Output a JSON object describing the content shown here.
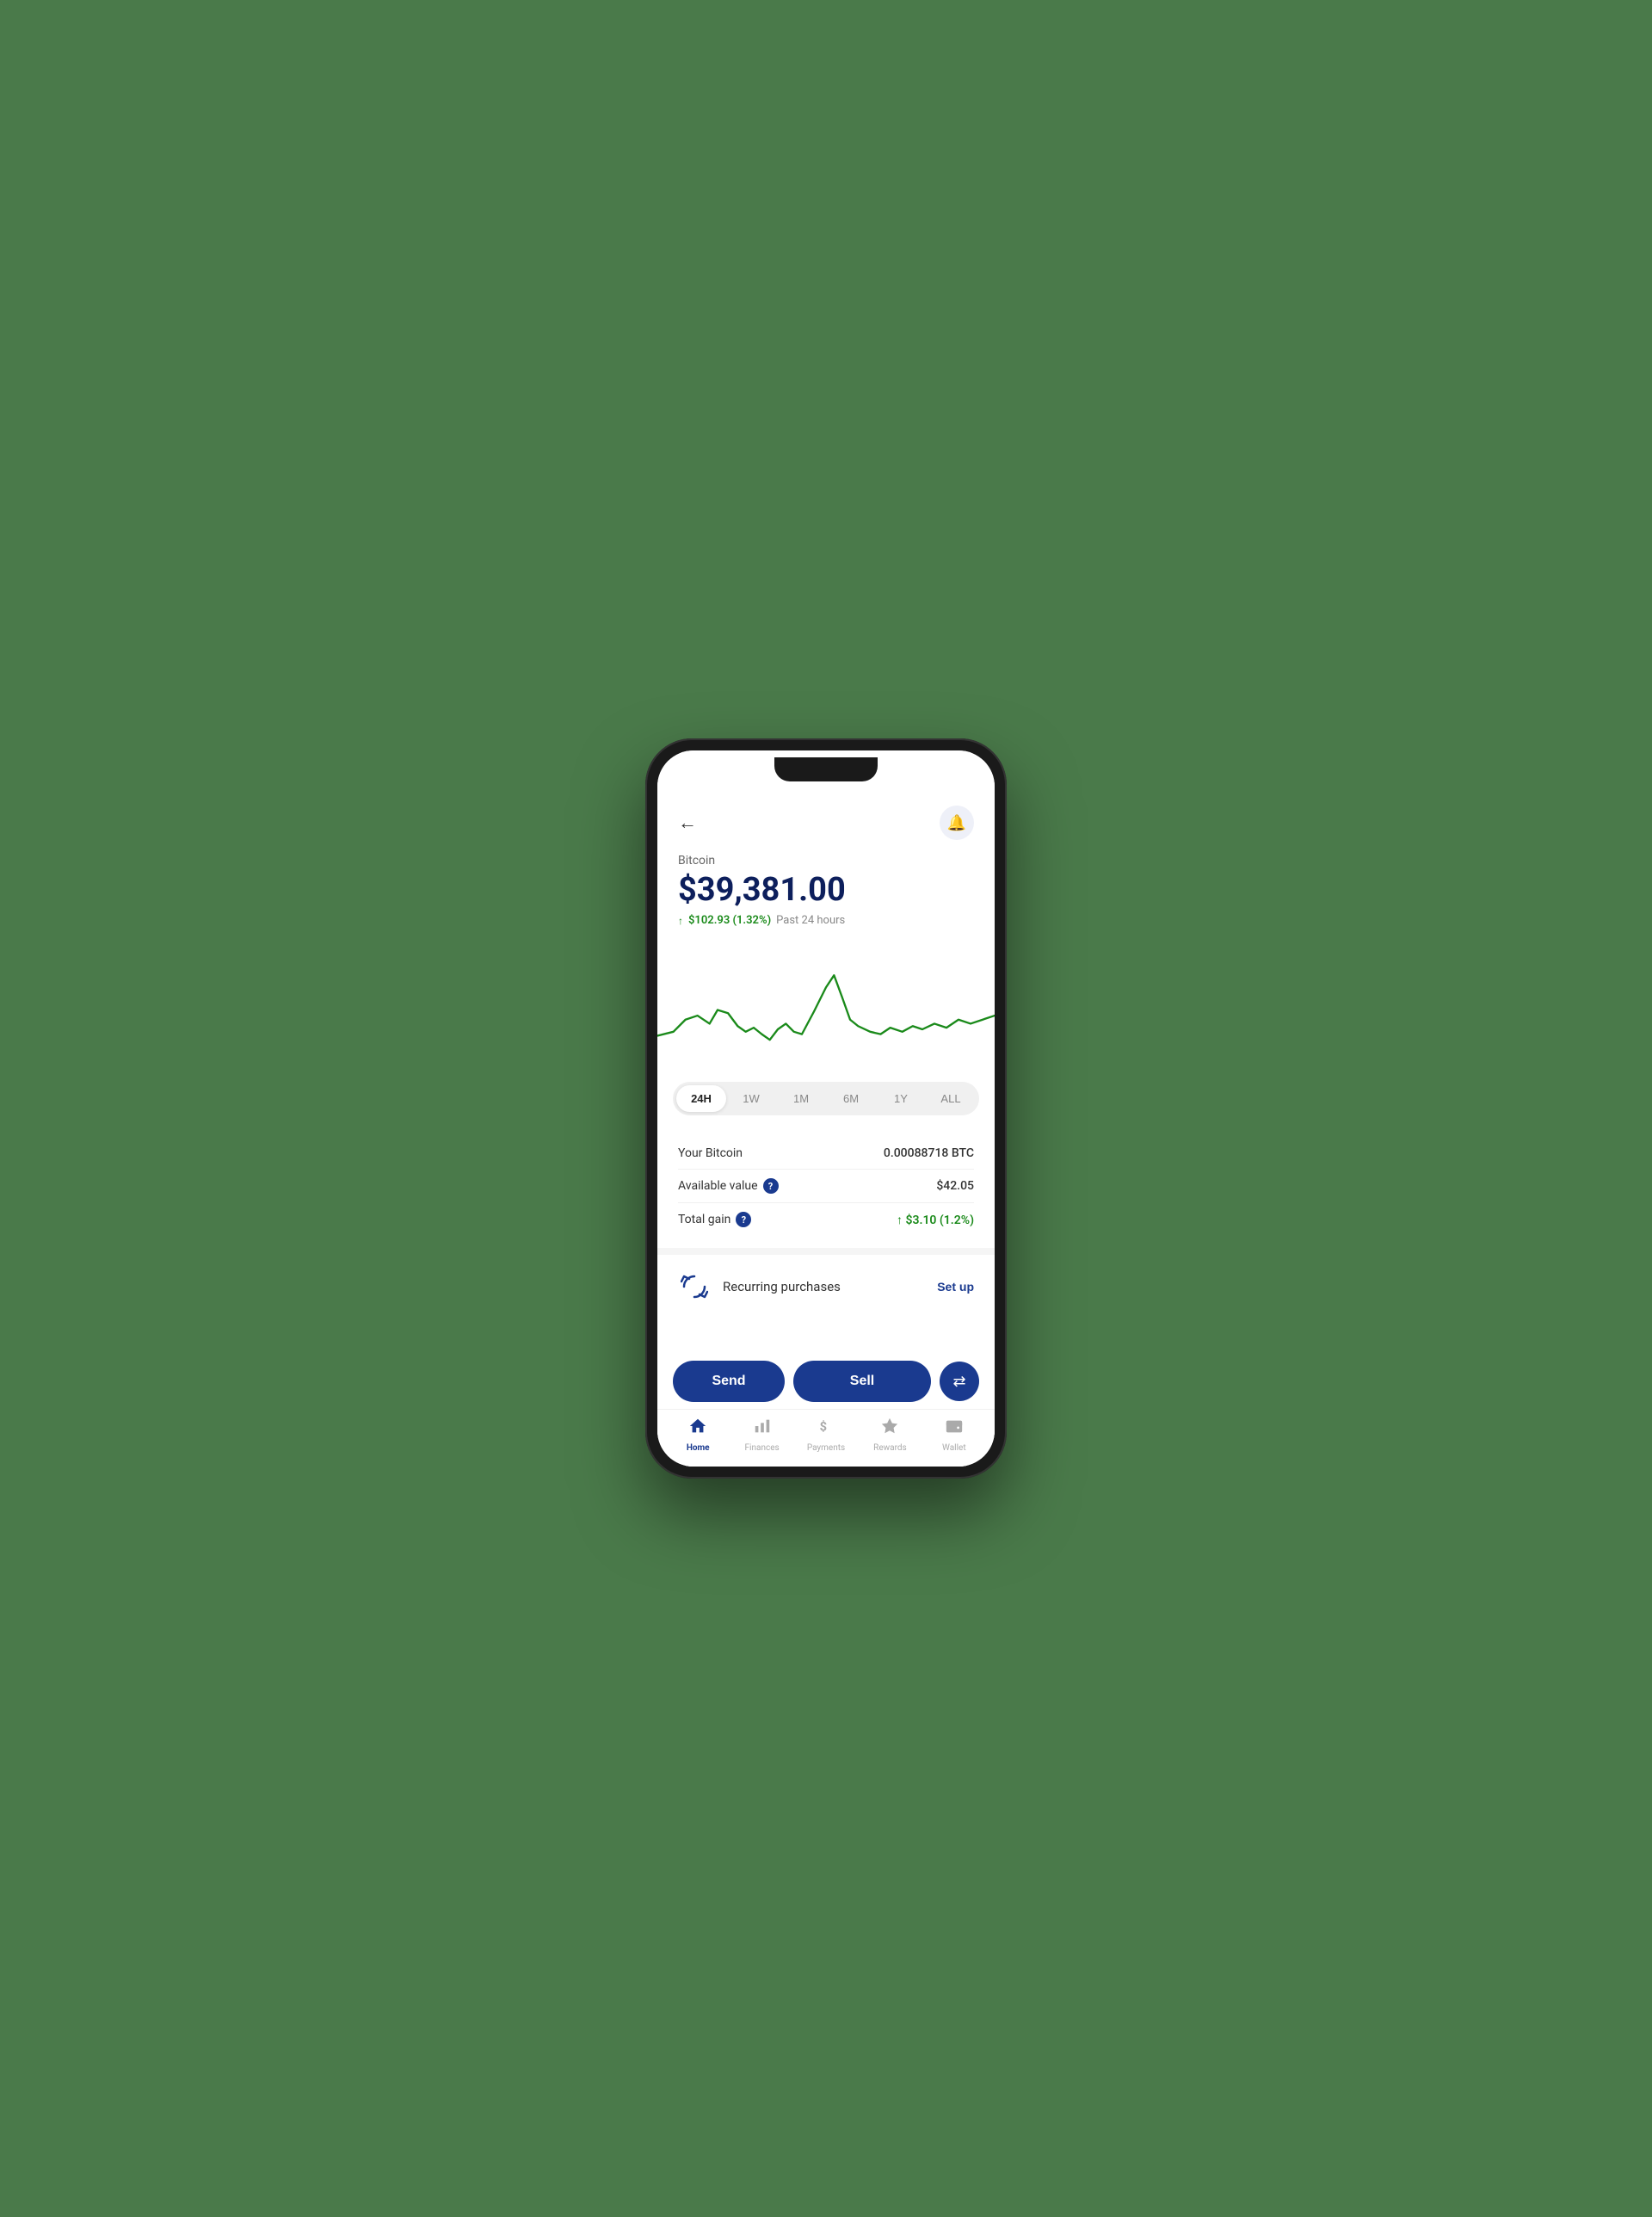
{
  "header": {
    "back_label": "←",
    "bell_label": "🔔"
  },
  "price": {
    "coin_name": "Bitcoin",
    "price": "$39,381.00",
    "change_amount": "$102.93 (1.32%)",
    "change_period": "Past 24 hours"
  },
  "chart": {
    "time_filters": [
      "24H",
      "1W",
      "1M",
      "6M",
      "1Y",
      "ALL"
    ],
    "active_filter": "24H"
  },
  "stats": {
    "your_bitcoin_label": "Your Bitcoin",
    "your_bitcoin_value": "0.00088718 BTC",
    "available_value_label": "Available value",
    "available_value_value": "$42.05",
    "total_gain_label": "Total gain",
    "total_gain_value": "↑ $3.10 (1.2%)"
  },
  "recurring": {
    "label": "Recurring purchases",
    "setup_label": "Set up"
  },
  "actions": {
    "send_label": "Send",
    "sell_label": "Sell",
    "swap_icon": "⇄"
  },
  "nav": {
    "items": [
      {
        "id": "home",
        "icon": "🏠",
        "label": "Home",
        "active": true
      },
      {
        "id": "finances",
        "icon": "📊",
        "label": "Finances",
        "active": false
      },
      {
        "id": "payments",
        "icon": "$",
        "label": "Payments",
        "active": false
      },
      {
        "id": "rewards",
        "icon": "🏆",
        "label": "Rewards",
        "active": false
      },
      {
        "id": "wallet",
        "icon": "🪙",
        "label": "Wallet",
        "active": false
      }
    ]
  }
}
